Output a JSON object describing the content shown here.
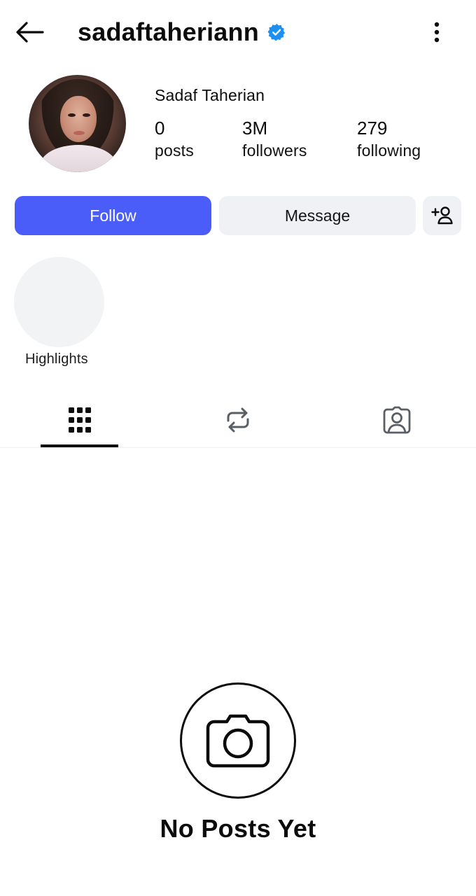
{
  "header": {
    "username": "sadaftaheriann",
    "back_icon": "arrow-left-icon",
    "verified_icon": "verified-badge-icon",
    "more_icon": "more-vertical-icon"
  },
  "profile": {
    "full_name": "Sadaf Taherian",
    "stats": {
      "posts": {
        "value": "0",
        "label": "posts"
      },
      "followers": {
        "value": "3M",
        "label": "followers"
      },
      "following": {
        "value": "279",
        "label": "following"
      }
    }
  },
  "actions": {
    "follow_label": "Follow",
    "message_label": "Message",
    "add_user_icon": "add-user-icon"
  },
  "highlights": {
    "label": "Highlights"
  },
  "tabs": [
    {
      "icon": "grid-icon",
      "active": true
    },
    {
      "icon": "repost-icon",
      "active": false
    },
    {
      "icon": "tagged-icon",
      "active": false
    }
  ],
  "empty_state": {
    "icon": "camera-icon",
    "title": "No Posts Yet"
  },
  "colors": {
    "follow_button": "#4a5df9",
    "secondary_button": "#eff1f4",
    "verified_badge": "#1d8ff0",
    "text": "#0c0c0c"
  }
}
